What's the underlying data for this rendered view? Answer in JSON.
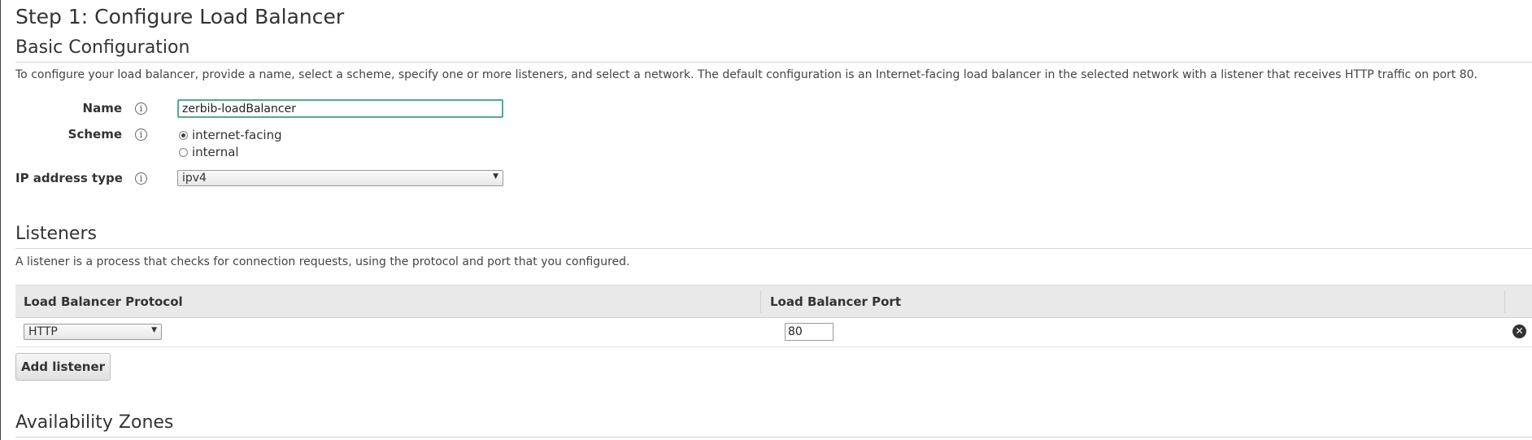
{
  "title": "Step 1: Configure Load Balancer",
  "basic": {
    "heading": "Basic Configuration",
    "description": "To configure your load balancer, provide a name, select a scheme, specify one or more listeners, and select a network. The default configuration is an Internet-facing load balancer in the selected network with a listener that receives HTTP traffic on port 80.",
    "name_label": "Name",
    "name_value": "zerbib-loadBalancer",
    "scheme_label": "Scheme",
    "scheme_options": [
      "internet-facing",
      "internal"
    ],
    "scheme_selected": "internet-facing",
    "ip_label": "IP address type",
    "ip_value": "ipv4",
    "info_glyph": "i"
  },
  "listeners": {
    "heading": "Listeners",
    "description": "A listener is a process that checks for connection requests, using the protocol and port that you configured.",
    "columns": [
      "Load Balancer Protocol",
      "Load Balancer Port"
    ],
    "rows": [
      {
        "protocol": "HTTP",
        "port": "80"
      }
    ],
    "add_button": "Add listener"
  },
  "availability": {
    "heading": "Availability Zones"
  },
  "icons": {
    "info": "info-icon",
    "remove": "remove-circle-icon",
    "dropdown": "dropdown-arrow-icon"
  },
  "colors": {
    "focus_border": "#57a88c",
    "table_header_bg": "#e9e9e9"
  }
}
